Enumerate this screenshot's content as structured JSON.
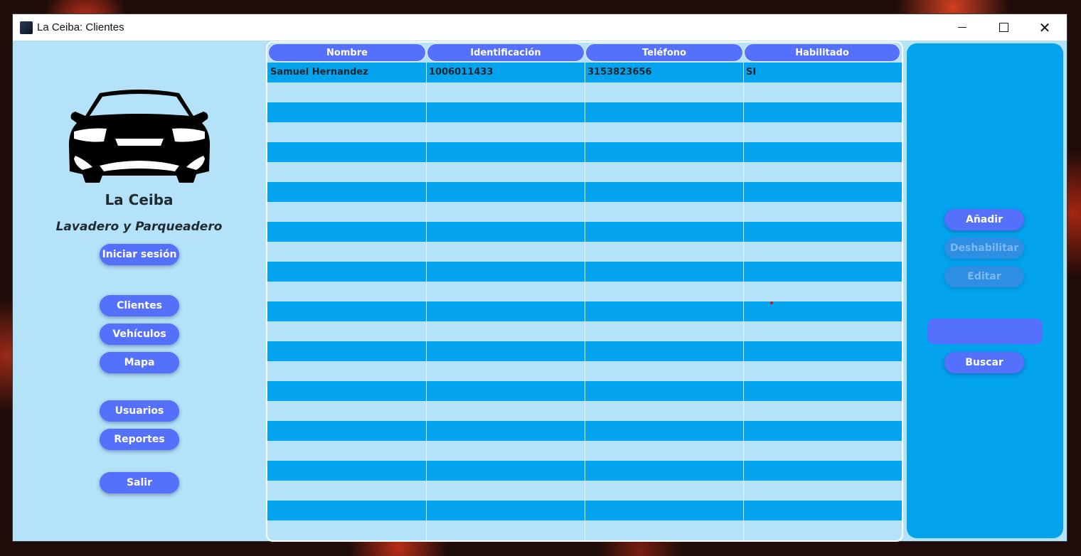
{
  "window": {
    "title": "La Ceiba: Clientes",
    "controls": {
      "minimize": "minimize-icon",
      "maximize": "maximize-icon",
      "close": "close-icon"
    }
  },
  "sidebar": {
    "logo": "car-icon",
    "brand_title": "La Ceiba",
    "brand_subtitle": "Lavadero y Parqueadero",
    "login_label": "Iniciar sesión",
    "nav": {
      "clientes": "Clientes",
      "vehiculos": "Vehículos",
      "mapa": "Mapa",
      "usuarios": "Usuarios",
      "reportes": "Reportes",
      "salir": "Salir"
    }
  },
  "table": {
    "columns": [
      "Nombre",
      "Identificación",
      "Teléfono",
      "Habilitado"
    ],
    "rows": [
      [
        "Samuel Hernandez",
        "1006011433",
        "3153823656",
        "SI"
      ]
    ]
  },
  "actions": {
    "add_label": "Añadir",
    "disable_label": "Deshabilitar",
    "edit_label": "Editar",
    "search_value": "",
    "search_label": "Buscar"
  },
  "colors": {
    "accent": "#5570fb",
    "panel_light": "#b4e3f9",
    "panel_dark": "#03a3ee"
  }
}
